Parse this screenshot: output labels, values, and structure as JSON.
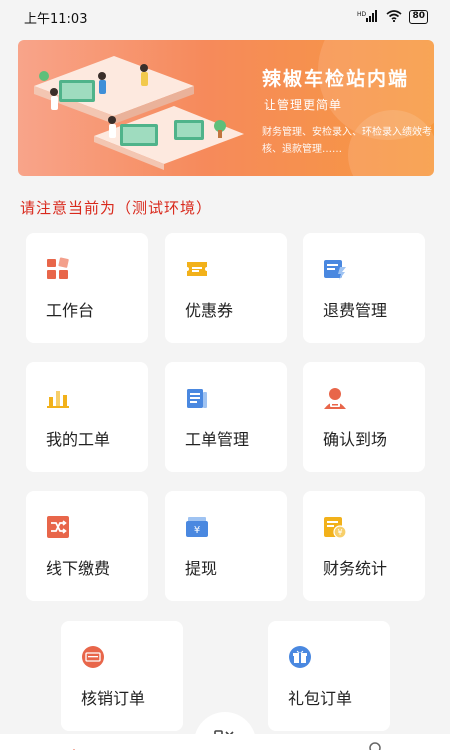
{
  "status_bar": {
    "time": "上午11:03",
    "network": "HD",
    "battery": "80"
  },
  "banner": {
    "title": "辣椒车检站内端",
    "subtitle": "让管理更简单",
    "description": "财务管理、安检录入、环检录入绩效考核、退款管理……"
  },
  "notice": "请注意当前为（测试环境）",
  "tiles": [
    {
      "label": "工作台",
      "icon": "dashboard-icon",
      "color": "#e8664a"
    },
    {
      "label": "优惠券",
      "icon": "coupon-icon",
      "color": "#f2b11a"
    },
    {
      "label": "退费管理",
      "icon": "refund-icon",
      "color": "#4a88e0"
    },
    {
      "label": "我的工单",
      "icon": "bar-chart-icon",
      "color": "#f2b11a"
    },
    {
      "label": "工单管理",
      "icon": "document-icon",
      "color": "#4a88e0"
    },
    {
      "label": "确认到场",
      "icon": "user-check-icon",
      "color": "#e8664a"
    },
    {
      "label": "线下缴费",
      "icon": "shuffle-icon",
      "color": "#e8664a"
    },
    {
      "label": "提现",
      "icon": "wallet-icon",
      "color": "#4a88e0"
    },
    {
      "label": "财务统计",
      "icon": "finance-icon",
      "color": "#f2b11a"
    },
    {
      "label": "核销订单",
      "icon": "stamp-icon",
      "color": "#e8664a"
    },
    {
      "label": "礼包订单",
      "icon": "gift-icon",
      "color": "#4a88e0"
    }
  ],
  "bottom_nav": {
    "items": [
      "home-icon",
      "tools-icon",
      "profile-icon"
    ]
  }
}
